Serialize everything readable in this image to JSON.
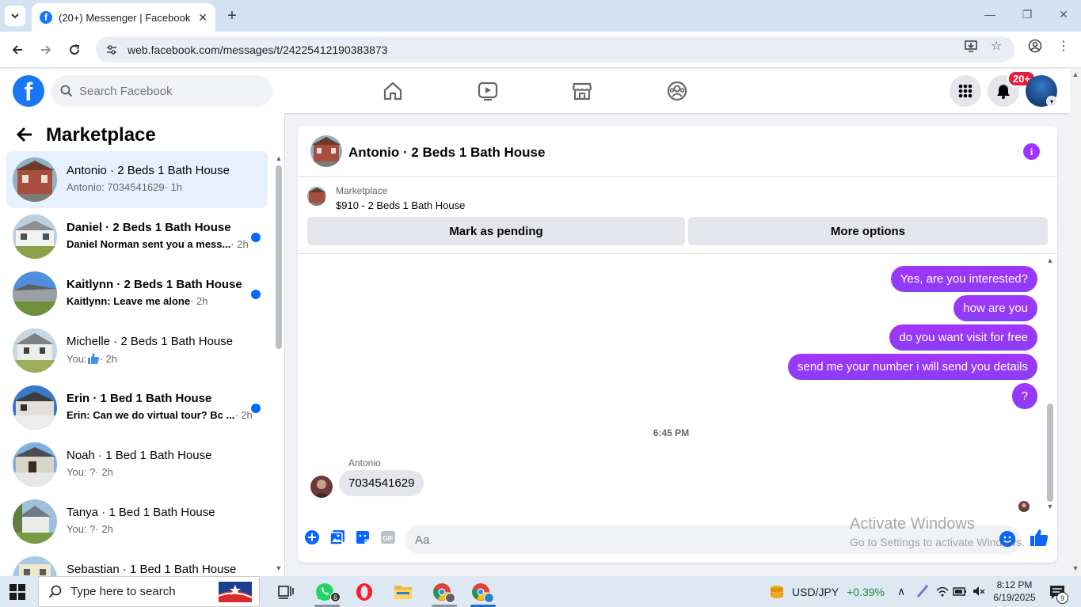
{
  "browser": {
    "tab_title": "(20+) Messenger | Facebook",
    "url": "web.facebook.com/messages/t/24225412190383873"
  },
  "fb_header": {
    "search_placeholder": "Search Facebook",
    "notification_badge": "20+"
  },
  "sidebar": {
    "title": "Marketplace",
    "conversations": [
      {
        "name": "Antonio · 2 Beds 1 Bath House",
        "preview": "Antonio: 7034541629",
        "time": " · 1h",
        "unread": false,
        "active": true
      },
      {
        "name": "Daniel · 2 Beds 1 Bath House",
        "preview": "Daniel Norman sent you a mess...",
        "time": " · 2h",
        "unread": true,
        "active": false
      },
      {
        "name": "Kaitlynn · 2 Beds 1 Bath House",
        "preview": "Kaitlynn: Leave me alone",
        "time": " · 2h",
        "unread": true,
        "active": false
      },
      {
        "name": "Michelle · 2 Beds 1 Bath House",
        "preview": "You: ",
        "time": " · 2h",
        "unread": false,
        "active": false
      },
      {
        "name": "Erin · 1 Bed 1 Bath House",
        "preview": "Erin: Can we do virtual tour? Bc ...",
        "time": " · 2h",
        "unread": true,
        "active": false
      },
      {
        "name": "Noah · 1 Bed 1 Bath House",
        "preview": "You: ?",
        "time": " · 2h",
        "unread": false,
        "active": false
      },
      {
        "name": "Tanya · 1 Bed 1 Bath House",
        "preview": "You: ?",
        "time": " · 2h",
        "unread": false,
        "active": false
      },
      {
        "name": "Sebastian · 1 Bed 1 Bath House",
        "preview": "",
        "time": "",
        "unread": false,
        "active": false
      }
    ]
  },
  "chat": {
    "title": "Antonio · 2 Beds 1 Bath House",
    "marketplace_label": "Marketplace",
    "listing": "$910 - 2 Beds 1 Bath House",
    "mark_pending_label": "Mark as pending",
    "more_options_label": "More options",
    "outgoing": [
      "Yes, are you interested?",
      "how are you",
      "do you want visit for free",
      "send me your number i will send you details",
      "?"
    ],
    "timestamp": "6:45 PM",
    "sender": "Antonio",
    "incoming": "7034541629",
    "input_placeholder": "Aa"
  },
  "watermark": {
    "line1": "Activate Windows",
    "line2": "Go to Settings to activate Windows."
  },
  "taskbar": {
    "search_placeholder": "Type here to search",
    "whatsapp_badge": "6",
    "ticker_pair": "USD/JPY",
    "ticker_change": "+0.39%",
    "time": "8:12 PM",
    "date": "6/19/2025",
    "notification_count": "9"
  },
  "colors": {
    "fb_blue": "#1877f2",
    "messenger_purple": "#a033ff",
    "unread_dot": "#0866ff"
  }
}
